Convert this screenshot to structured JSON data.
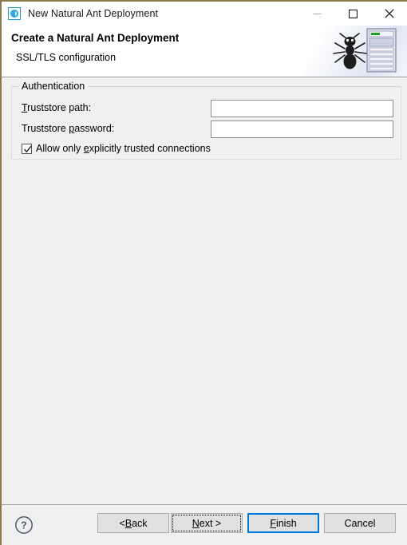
{
  "window": {
    "title": "New Natural Ant Deployment",
    "app_icon": "natural-logo-icon",
    "controls": {
      "minimize": "minimize-icon",
      "maximize": "maximize-icon",
      "close": "close-icon"
    },
    "border_color": "#8c7b4a"
  },
  "header": {
    "title": "Create a Natural Ant Deployment",
    "subtitle": "SSL/TLS configuration",
    "graphic": "ant-and-server-banner-icon"
  },
  "content": {
    "group": {
      "legend": "Authentication",
      "fields": [
        {
          "label_pre": "",
          "label_mnemonic": "T",
          "label_post": "ruststore path:",
          "label_full": "Truststore path:",
          "value": "",
          "placeholder": ""
        },
        {
          "label_pre": "Truststore ",
          "label_mnemonic": "p",
          "label_post": "assword:",
          "label_full": "Truststore password:",
          "value": "",
          "placeholder": ""
        }
      ],
      "checkbox": {
        "label_pre": "Allow only ",
        "label_mnemonic": "e",
        "label_post": "xplicitly trusted connections",
        "label_full": "Allow only explicitly trusted connections",
        "checked": true
      }
    }
  },
  "footer": {
    "help": "help-icon",
    "buttons": [
      {
        "name": "back",
        "label_pre": "< ",
        "label_mnemonic": "B",
        "label_post": "ack",
        "label_full": "< Back",
        "state": "enabled"
      },
      {
        "name": "next",
        "label_pre": "",
        "label_mnemonic": "N",
        "label_post": "ext >",
        "label_full": "Next >",
        "state": "focused"
      },
      {
        "name": "finish",
        "label_pre": "",
        "label_mnemonic": "F",
        "label_post": "inish",
        "label_full": "Finish",
        "state": "default"
      },
      {
        "name": "cancel",
        "label_pre": "",
        "label_mnemonic": "",
        "label_post": "Cancel",
        "label_full": "Cancel",
        "state": "enabled"
      }
    ],
    "default_button_color": "#0078d7"
  }
}
